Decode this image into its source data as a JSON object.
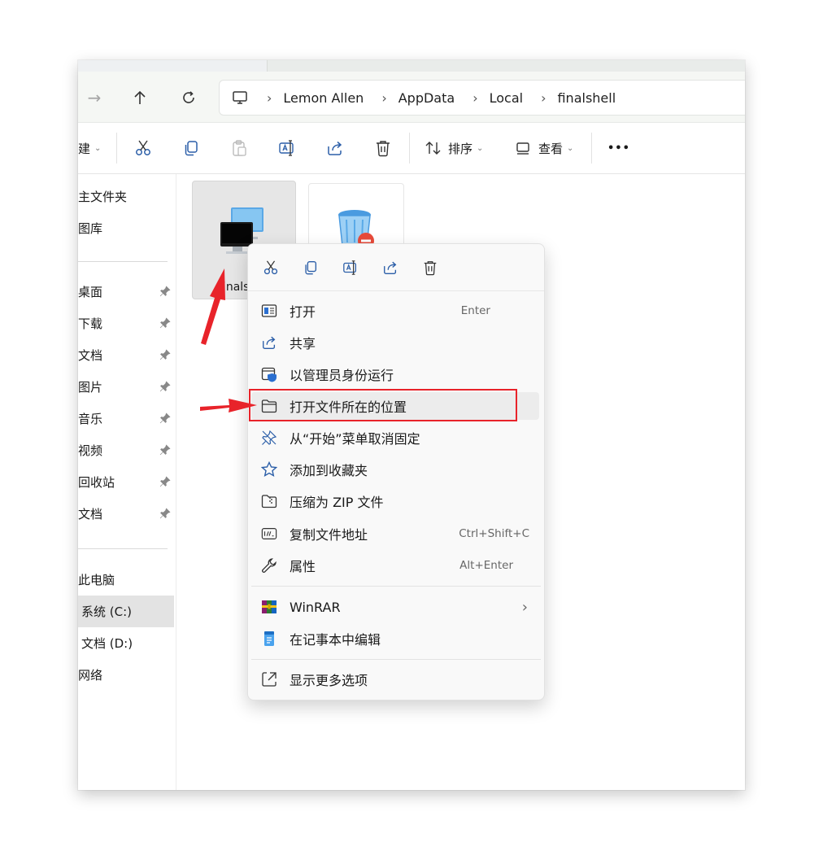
{
  "address": {
    "crumbs": [
      "Lemon Allen",
      "AppData",
      "Local",
      "finalshell"
    ]
  },
  "toolbar": {
    "new_label": "建",
    "sort_label": "排序",
    "view_label": "查看",
    "more_label": "•••"
  },
  "sidebar": {
    "quick": [
      "主文件夹",
      "图库"
    ],
    "pinned": [
      "桌面",
      "下载",
      "文档",
      "图片",
      "音乐",
      "视频",
      "回收站",
      "文档"
    ],
    "pc": [
      "此电脑",
      "系统 (C:)",
      "文档 (D:)",
      "网络"
    ]
  },
  "files": [
    {
      "name": "finalshell"
    },
    {
      "name": ""
    }
  ],
  "context_menu": {
    "top_actions": [
      "cut",
      "copy",
      "rename",
      "share",
      "delete"
    ],
    "items": [
      {
        "label": "打开",
        "shortcut": "Enter",
        "icon": "open-window-icon"
      },
      {
        "label": "共享",
        "shortcut": "",
        "icon": "share-icon"
      },
      {
        "label": "以管理员身份运行",
        "shortcut": "",
        "icon": "shield-icon"
      },
      {
        "label": "打开文件所在的位置",
        "shortcut": "",
        "icon": "folder-icon"
      },
      {
        "label": "从“开始”菜单取消固定",
        "shortcut": "",
        "icon": "unpin-icon"
      },
      {
        "label": "添加到收藏夹",
        "shortcut": "",
        "icon": "star-icon"
      },
      {
        "label": "压缩为 ZIP 文件",
        "shortcut": "",
        "icon": "zip-icon"
      },
      {
        "label": "复制文件地址",
        "shortcut": "Ctrl+Shift+C",
        "icon": "copy-path-icon"
      },
      {
        "label": "属性",
        "shortcut": "Alt+Enter",
        "icon": "wrench-icon"
      }
    ],
    "group2": [
      {
        "label": "WinRAR",
        "icon": "winrar-icon",
        "submenu": "›"
      },
      {
        "label": "在记事本中编辑",
        "icon": "notepad-icon"
      }
    ],
    "group3": [
      {
        "label": "显示更多选项",
        "icon": "more-options-icon"
      }
    ]
  },
  "colors": {
    "accent": "#1a6fd4",
    "annotation": "#e8232a"
  }
}
